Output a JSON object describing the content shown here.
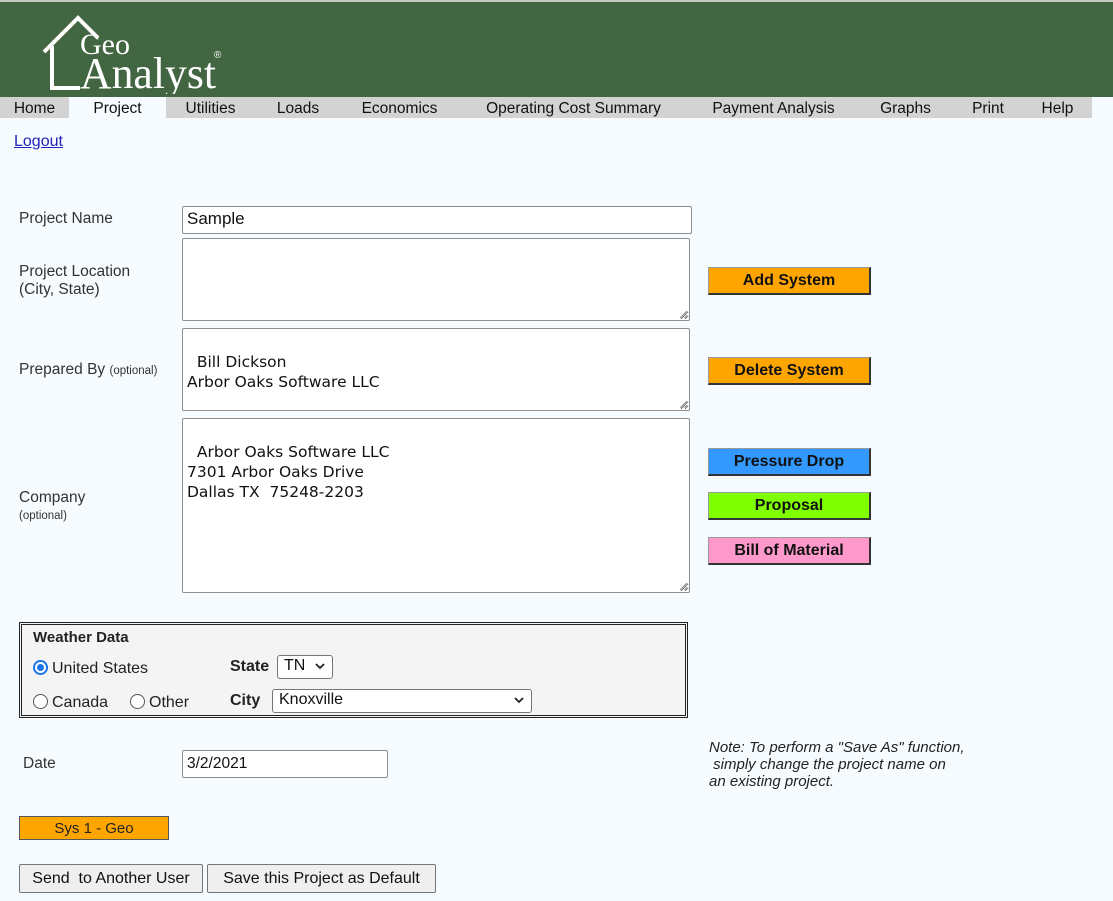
{
  "logo": {
    "line1": "Geo",
    "line2": "Analyst",
    "mark": "®"
  },
  "nav": {
    "items": [
      {
        "label": "Home"
      },
      {
        "label": "Project"
      },
      {
        "label": "Utilities"
      },
      {
        "label": "Loads"
      },
      {
        "label": "Economics"
      },
      {
        "label": "Operating Cost Summary"
      },
      {
        "label": "Payment Analysis"
      },
      {
        "label": "Graphs"
      },
      {
        "label": "Print"
      },
      {
        "label": "Help"
      }
    ],
    "active": "Project"
  },
  "logout": "Logout",
  "form": {
    "project_name_label": "Project Name",
    "project_name_value": "Sample",
    "location_label_1": "Project Location",
    "location_label_2": "(City, State)",
    "location_value": "",
    "prepared_label": "Prepared By",
    "prepared_opt": "(optional)",
    "prepared_value": "Bill Dickson\nArbor Oaks Software LLC",
    "company_label": "Company",
    "company_opt": "(optional)",
    "company_value": "Arbor Oaks Software LLC\n7301 Arbor Oaks Drive\nDallas TX  75248-2203",
    "date_label": "Date",
    "date_value": "3/2/2021"
  },
  "side_buttons": {
    "add_system": {
      "label": "Add System",
      "color": "#ffa500"
    },
    "delete_system": {
      "label": "Delete System",
      "color": "#ffa500"
    },
    "pressure_drop": {
      "label": "Pressure Drop",
      "color": "#3399ff"
    },
    "proposal": {
      "label": "Proposal",
      "color": "#80ff00"
    },
    "bill_of_material": {
      "label": "Bill of Material",
      "color": "#ff99cc"
    }
  },
  "weather": {
    "title": "Weather Data",
    "country_options": [
      {
        "label": "United States",
        "checked": true
      },
      {
        "label": "Canada",
        "checked": false
      },
      {
        "label": "Other",
        "checked": false
      }
    ],
    "state_label": "State",
    "state_value": "TN",
    "city_label": "City",
    "city_value": "Knoxville"
  },
  "note": {
    "line1": "Note: To perform a \"Save As\" function,",
    "line2": " simply change the project name on",
    "line3": "an existing project."
  },
  "system_tab": "Sys 1 - Geo",
  "bottom_buttons": {
    "send": "Send  to Another User",
    "save_default": "Save this Project as Default"
  },
  "colors": {
    "header_bg": "#426641",
    "nav_bg": "#d3d3d3",
    "page_bg": "#f5fbff",
    "system_tab": "#ffa500"
  }
}
